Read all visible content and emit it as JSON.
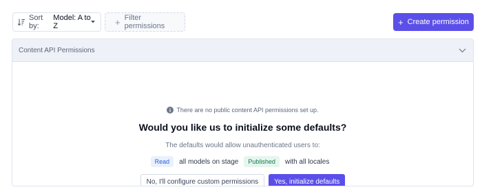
{
  "toolbar": {
    "sort": {
      "prefix": "Sort by:",
      "value": "Model: A to Z",
      "icon": "sort-icon"
    },
    "filter_label": "Filter permissions",
    "create_label": "Create permission"
  },
  "panel": {
    "title": "Content API Permissions",
    "info_text": "There are no public content API permissions set up.",
    "heading": "Would you like us to initialize some defaults?",
    "description": "The defaults would allow unauthenticated users to:",
    "defaults": {
      "action_badge": "Read",
      "middle_text": "all models on stage",
      "stage_badge": "Published",
      "end_text": "with all locales"
    },
    "custom_button": "No, I'll configure custom permissions",
    "init_button": "Yes, initialize defaults"
  },
  "colors": {
    "accent": "#5b4fe9",
    "header_bg": "#eef1f7",
    "read_badge_bg": "#eaf1fd",
    "published_badge_bg": "#e6f6ee"
  }
}
